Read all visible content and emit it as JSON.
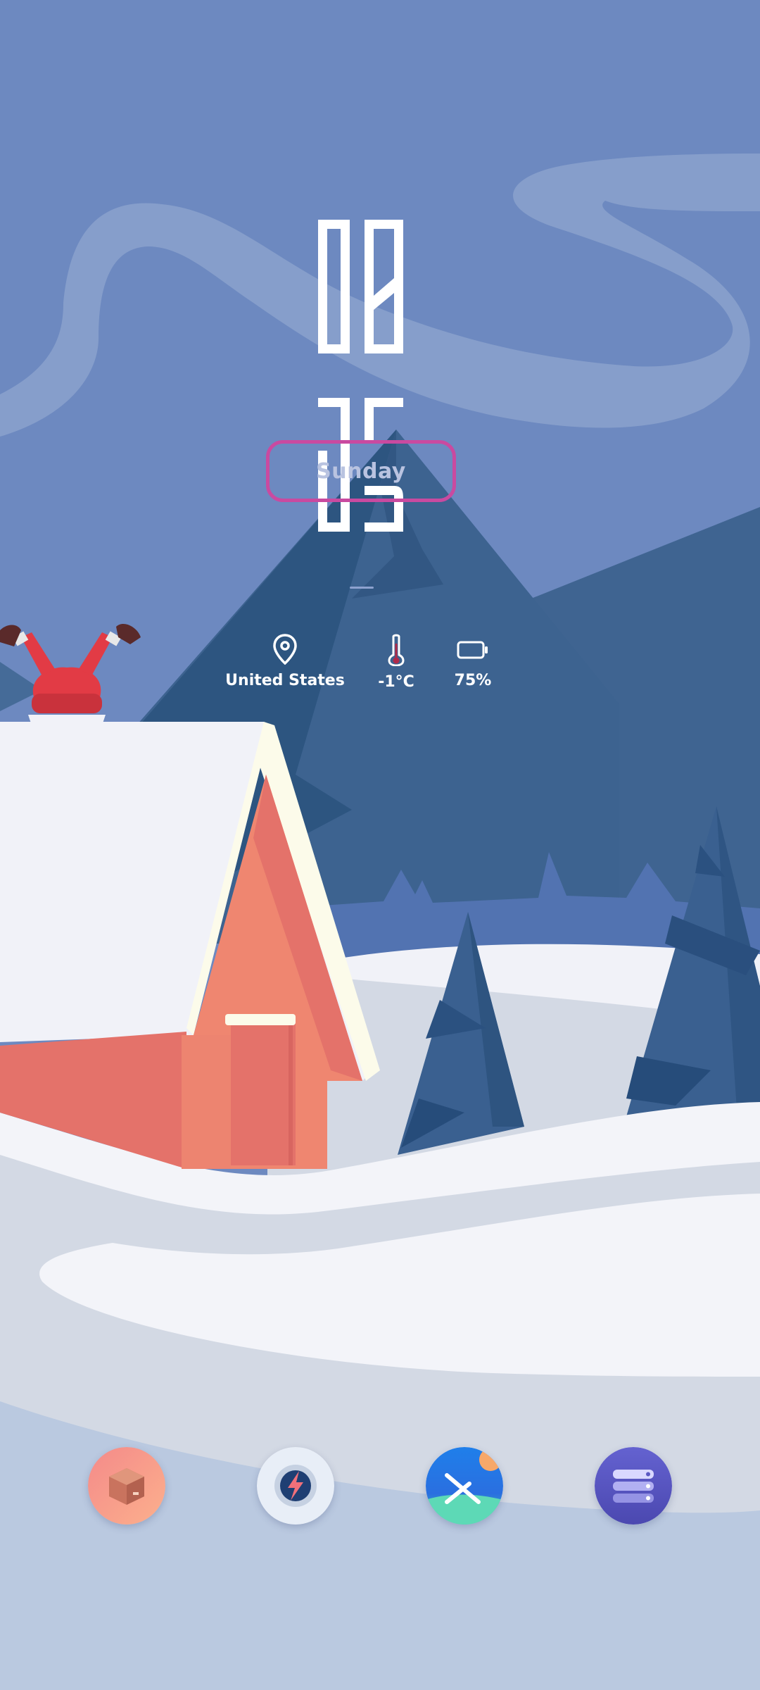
{
  "lockscreen": {
    "clock": {
      "hours": "09",
      "minutes": "15"
    },
    "day": "Sunday",
    "status_items": [
      {
        "icon": "location-pin-icon",
        "label": "United States"
      },
      {
        "icon": "thermometer-icon",
        "label": "-1°C"
      },
      {
        "icon": "battery-icon",
        "label": "75%"
      }
    ]
  },
  "dock": {
    "apps": [
      {
        "icon": "package-app-icon",
        "color": "#f6928a"
      },
      {
        "icon": "compass-bolt-app-icon",
        "color": "#e8eef7"
      },
      {
        "icon": "blue-landscape-app-icon",
        "color": "#1f7fea"
      },
      {
        "icon": "server-stack-app-icon",
        "color": "#5b59c3"
      }
    ]
  },
  "colors": {
    "sky": "#6d89c0",
    "mountain": "#3f6491",
    "snow": "#f3f4f9",
    "house_red": "#e4726a",
    "day_chip_border": "#c94aa0"
  }
}
